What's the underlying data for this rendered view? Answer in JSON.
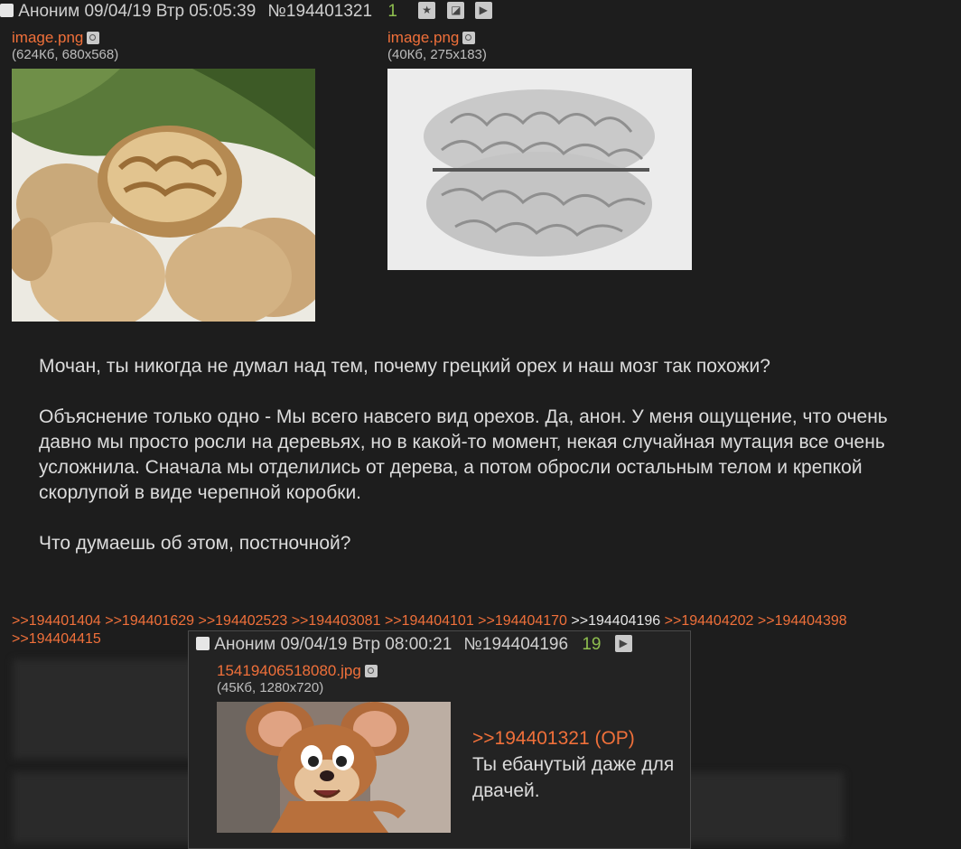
{
  "post": {
    "author": "Аноним",
    "datetime": "09/04/19 Втр 05:05:39",
    "number": "№194401321",
    "count": "1",
    "files": [
      {
        "name": "image.png",
        "info": "(624Кб, 680x568)",
        "icon": "walnut-image"
      },
      {
        "name": "image.png",
        "info": "(40Кб, 275x183)",
        "icon": "brain-image"
      }
    ],
    "paragraphs": [
      "Мочан, ты никогда не думал над тем, почему грецкий орех и наш мозг так похожи?",
      "Объяснение только одно - Мы всего навсего вид орехов. Да, анон. У меня ощущение, что очень давно мы просто росли на деревьях, но в какой-то момент, некая случайная мутация все очень усложнила. Сначала мы отделились от дерева, а потом обросли остальным телом и крепкой скорлупой в виде черепной коробки.",
      "Что думаешь об этом, постночной?"
    ],
    "replies": [
      ">>194401404",
      ">>194401629",
      ">>194402523",
      ">>194403081",
      ">>194404101",
      ">>194404170",
      ">>194404196",
      ">>194404202",
      ">>194404398",
      ">>194404415"
    ]
  },
  "popup": {
    "author": "Аноним",
    "datetime": "09/04/19 Втр 08:00:21",
    "number": "№194404196",
    "count": "19",
    "file": {
      "name": "15419406518080.jpg",
      "info": "(45Кб, 1280x720)",
      "icon": "jerry-mouse-image"
    },
    "quote": ">>194401321 (OP)",
    "text": "Ты ебанутый даже для двачей."
  },
  "colors": {
    "link": "#f0703a",
    "count": "#8fbf4f",
    "background": "#1d1d1d"
  }
}
